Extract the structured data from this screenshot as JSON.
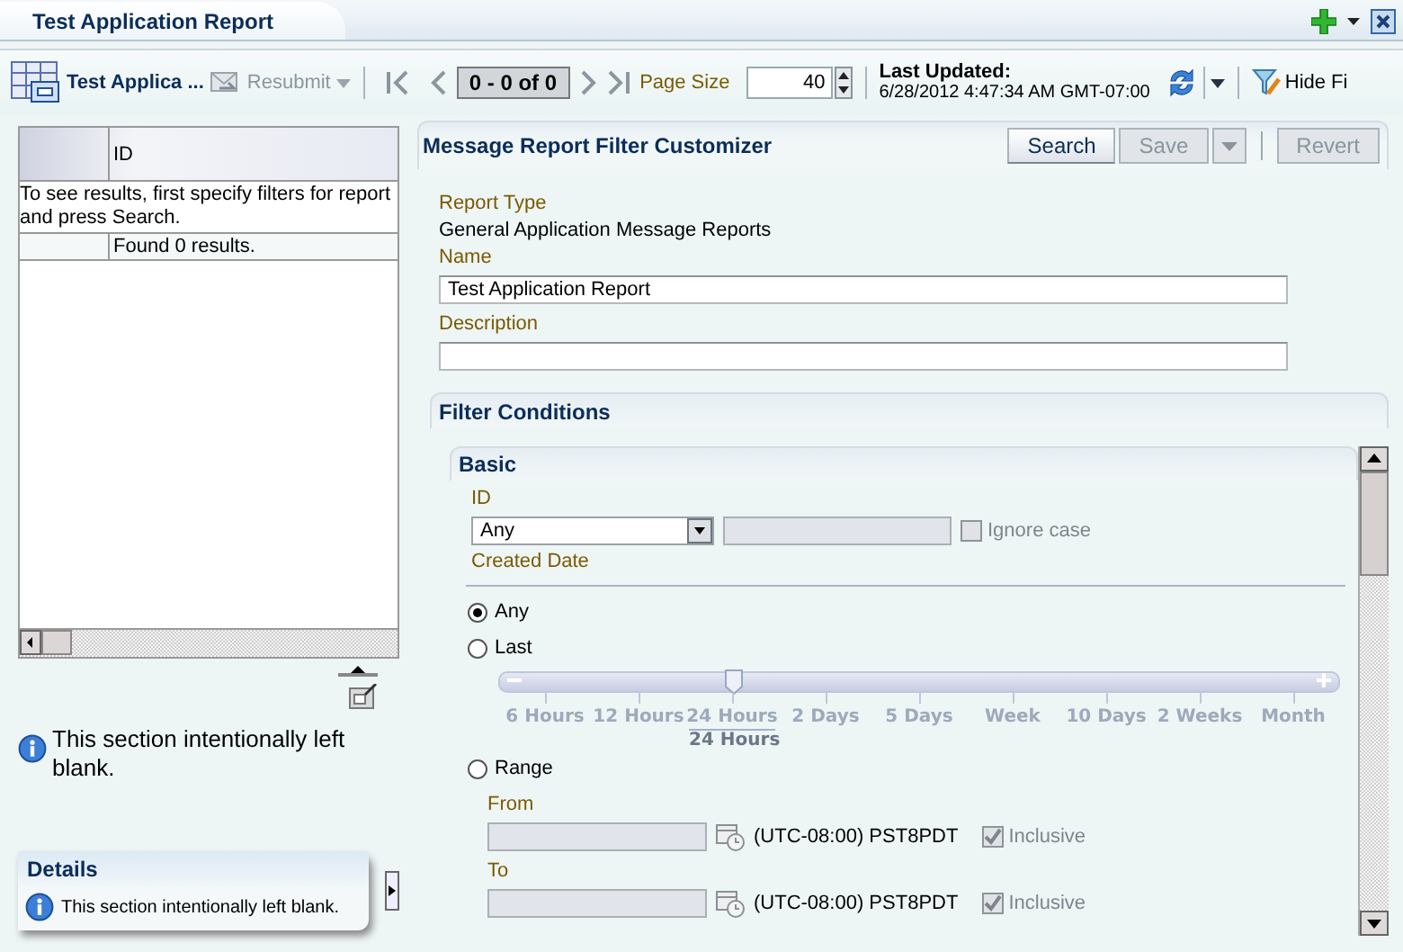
{
  "tab": {
    "title": "Test Application Report",
    "selected": true
  },
  "toolbar": {
    "report_title": "Test Applica ...",
    "resubmit": {
      "label": "Resubmit",
      "disabled": true
    },
    "range": "0 - 0 of 0",
    "page_size_label": "Page Size",
    "page_size": "40",
    "last_updated_label": "Last Updated:",
    "last_updated": "6/28/2012 4:47:34 AM GMT-07:00",
    "hide_filter": "Hide Fi"
  },
  "results_table": {
    "columns": [
      "ID"
    ],
    "message": "To see results, first specify filters for report and press Search.",
    "found": "Found 0 results."
  },
  "left_info": "This section intentionally left blank.",
  "details": {
    "title": "Details",
    "info": "This section intentionally left blank."
  },
  "customizer": {
    "title": "Message Report Filter Customizer",
    "buttons": [
      {
        "label": "Search",
        "disabled": false,
        "menu": false
      },
      {
        "label": "Save",
        "disabled": true,
        "menu": true
      },
      {
        "label": "Revert",
        "disabled": true,
        "menu": false
      }
    ],
    "report_type_label": "Report Type",
    "report_type": "General Application Message Reports",
    "name_label": "Name",
    "name": "Test Application Report",
    "description_label": "Description"
  },
  "filter": {
    "title": "Filter Conditions",
    "section": "Basic",
    "id_label": "ID",
    "id_operator": "Any",
    "ignore_case": {
      "label": "Ignore case",
      "checked": false,
      "disabled": true
    },
    "created_date_label": "Created Date",
    "date_options": [
      {
        "label": "Any",
        "selected": true
      },
      {
        "label": "Last",
        "selected": false
      },
      {
        "label": "Range",
        "selected": false
      }
    ],
    "slider": {
      "ticks": [
        "6 Hours",
        "12 Hours",
        "24 Hours",
        "2 Days",
        "5 Days",
        "Week",
        "10 Days",
        "2 Weeks",
        "Month"
      ],
      "level": 0.25,
      "value_label": "24 Hours"
    },
    "range_fields": [
      {
        "label": "From",
        "timezone": "(UTC-08:00) PST8PDT",
        "inclusive": {
          "label": "Inclusive",
          "checked": true,
          "disabled": true
        }
      },
      {
        "label": "To",
        "timezone": "(UTC-08:00) PST8PDT",
        "inclusive": {
          "label": "Inclusive",
          "checked": true,
          "disabled": true
        }
      }
    ]
  }
}
